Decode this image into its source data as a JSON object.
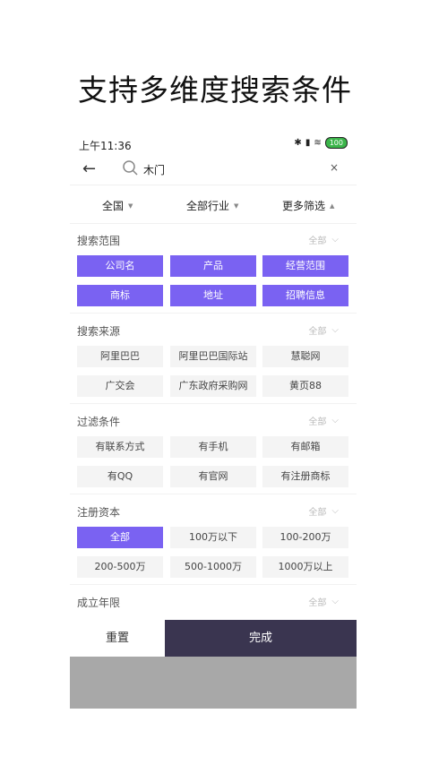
{
  "promo": {
    "title": "支持多维度搜索条件"
  },
  "status": {
    "time": "上午11:36",
    "battery": "100"
  },
  "search": {
    "query": "木门",
    "clear": "×",
    "back": "←"
  },
  "filters": {
    "region": "全国",
    "industry": "全部行业",
    "more": "更多筛选"
  },
  "all_label": "全部",
  "sections": {
    "scope": {
      "title": "搜索范围",
      "chips": [
        "公司名",
        "产品",
        "经营范围",
        "商标",
        "地址",
        "招聘信息"
      ]
    },
    "source": {
      "title": "搜索来源",
      "chips": [
        "阿里巴巴",
        "阿里巴巴国际站",
        "慧聪网",
        "广交会",
        "广东政府采购网",
        "黄页88"
      ]
    },
    "condition": {
      "title": "过滤条件",
      "chips": [
        "有联系方式",
        "有手机",
        "有邮箱",
        "有QQ",
        "有官网",
        "有注册商标"
      ]
    },
    "capital": {
      "title": "注册资本",
      "chips": [
        "全部",
        "100万以下",
        "100-200万",
        "200-500万",
        "500-1000万",
        "1000万以上"
      ]
    },
    "years": {
      "title": "成立年限"
    }
  },
  "actions": {
    "reset": "重置",
    "done": "完成"
  },
  "colors": {
    "accent": "#7a62f2",
    "done_bg": "#3a3550"
  }
}
